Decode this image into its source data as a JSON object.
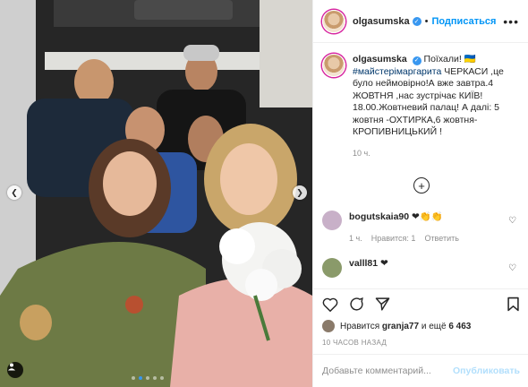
{
  "post": {
    "username": "olgasumska",
    "follow_label": "Подписаться",
    "more_label": "•••",
    "caption_text": "Поїхали!",
    "caption_hashtag": "#майстерімаргарита",
    "caption_rest": " ЧЕРКАСИ ,це було неймовірно!А вже завтра.4 ЖОВТНЯ ,нас зустрічає КИЇВ! 18.00.Жовтневий палац! А далі: 5 жовтня -ОХТИРКА,6 жовтня-КРОПИВНИЦЬКИЙ !",
    "caption_time": "10 ч.",
    "load_more_icon": "plus-circle-icon"
  },
  "comments": [
    {
      "user": "bogutskaia90",
      "text": "❤👏👏",
      "time": "1 ч.",
      "likes": "Нравится: 1",
      "reply": "Ответить",
      "avatar_color": "#c8b0c8"
    },
    {
      "user": "valll81",
      "text": "❤",
      "time": "",
      "likes": "",
      "reply": "",
      "avatar_color": "#8a9a6a"
    }
  ],
  "footer": {
    "likes_prefix": "Нравится",
    "likes_user": "granja77",
    "likes_mid": "и ещё",
    "likes_count": "6 463",
    "posted_ago": "10 ЧАСОВ НАЗАД",
    "comment_placeholder": "Добавьте комментарий...",
    "publish_label": "Опубликовать"
  },
  "colors": {
    "accent": "#0095f6",
    "border": "#efefef",
    "muted": "#8e8e8e"
  }
}
